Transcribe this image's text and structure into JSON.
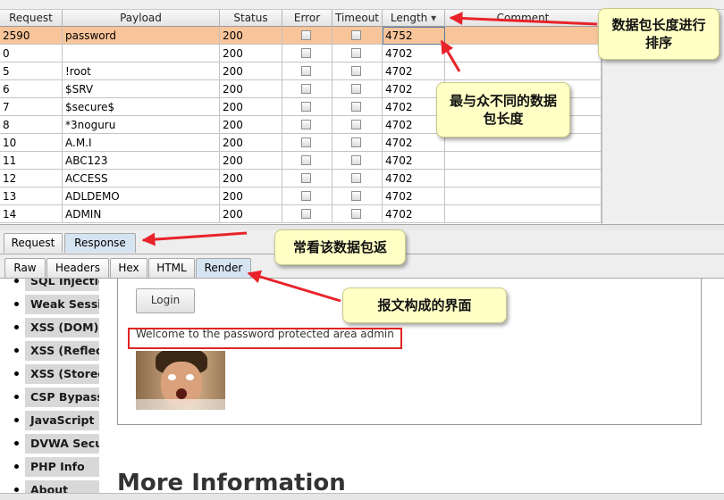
{
  "table": {
    "columns": [
      "Request",
      "Payload",
      "Status",
      "Error",
      "Timeout",
      "Length",
      "Comment"
    ],
    "rows": [
      {
        "request": "2590",
        "payload": "password",
        "status": "200",
        "length": "4752"
      },
      {
        "request": "0",
        "payload": "",
        "status": "200",
        "length": "4702"
      },
      {
        "request": "5",
        "payload": "!root",
        "status": "200",
        "length": "4702"
      },
      {
        "request": "6",
        "payload": "$SRV",
        "status": "200",
        "length": "4702"
      },
      {
        "request": "7",
        "payload": "$secure$",
        "status": "200",
        "length": "4702"
      },
      {
        "request": "8",
        "payload": "*3noguru",
        "status": "200",
        "length": "4702"
      },
      {
        "request": "10",
        "payload": "A.M.I",
        "status": "200",
        "length": "4702"
      },
      {
        "request": "11",
        "payload": "ABC123",
        "status": "200",
        "length": "4702"
      },
      {
        "request": "12",
        "payload": "ACCESS",
        "status": "200",
        "length": "4702"
      },
      {
        "request": "13",
        "payload": "ADLDEMO",
        "status": "200",
        "length": "4702"
      },
      {
        "request": "14",
        "payload": "ADMIN",
        "status": "200",
        "length": "4702"
      }
    ]
  },
  "tabs": {
    "main": [
      "Request",
      "Response"
    ],
    "sub": [
      "Raw",
      "Headers",
      "Hex",
      "HTML",
      "Render"
    ]
  },
  "render": {
    "menu": [
      "SQL Injection",
      "Weak Session IDs",
      "XSS (DOM)",
      "XSS (Reflected)",
      "XSS (Stored)",
      "CSP Bypass",
      "JavaScript",
      "DVWA Security",
      "PHP Info",
      "About"
    ],
    "login_button": "Login",
    "welcome": "Welcome to the password protected area admin",
    "heading": "More Information"
  },
  "annotations": {
    "sort": "数据包长度进行排序",
    "diff": "最与众不同的数据包长度",
    "view": "常看该数据包返",
    "render": "报文构成的界面"
  },
  "colors": {
    "selected_row": "#f8c499",
    "note_bg": "#ffffc6",
    "arrow": "#e8232a"
  }
}
